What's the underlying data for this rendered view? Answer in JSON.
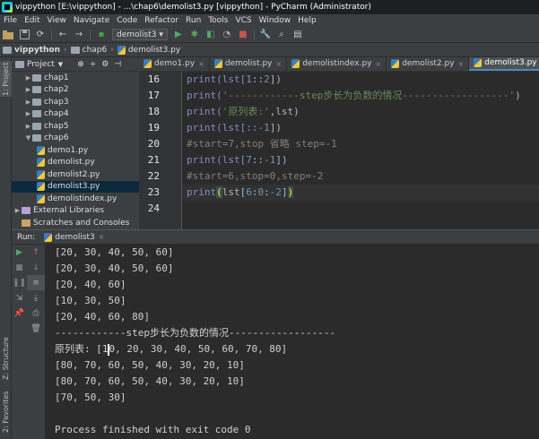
{
  "window": {
    "title": "vippython [E:\\vippython] - ...\\chap6\\demolist3.py [vippython] - PyCharm (Administrator)"
  },
  "menu": [
    "File",
    "Edit",
    "View",
    "Navigate",
    "Code",
    "Refactor",
    "Run",
    "Tools",
    "VCS",
    "Window",
    "Help"
  ],
  "toolbar": {
    "run_config": "demolist3 ▾"
  },
  "breadcrumbs": [
    "vippython",
    "chap6",
    "demolist3.py"
  ],
  "project_panel": {
    "title": "Project",
    "tree": [
      {
        "label": "chap1",
        "type": "folder",
        "depth": 1,
        "expanded": false
      },
      {
        "label": "chap2",
        "type": "folder",
        "depth": 1,
        "expanded": false
      },
      {
        "label": "chap3",
        "type": "folder",
        "depth": 1,
        "expanded": false
      },
      {
        "label": "chap4",
        "type": "folder",
        "depth": 1,
        "expanded": false
      },
      {
        "label": "chap5",
        "type": "folder",
        "depth": 1,
        "expanded": false
      },
      {
        "label": "chap6",
        "type": "folder",
        "depth": 1,
        "expanded": true
      },
      {
        "label": "demo1.py",
        "type": "file",
        "depth": 2
      },
      {
        "label": "demolist.py",
        "type": "file",
        "depth": 2
      },
      {
        "label": "demolist2.py",
        "type": "file",
        "depth": 2
      },
      {
        "label": "demolist3.py",
        "type": "file",
        "depth": 2,
        "selected": true
      },
      {
        "label": "demolistindex.py",
        "type": "file",
        "depth": 2
      },
      {
        "label": "External Libraries",
        "type": "lib",
        "depth": 0,
        "expanded": false
      },
      {
        "label": "Scratches and Consoles",
        "type": "scratch",
        "depth": 0
      }
    ]
  },
  "left_strip": {
    "project_tab": "1: Project",
    "structure_tab": "Z: Structure",
    "favorites_tab": "2: Favorites"
  },
  "tabs": [
    {
      "label": "demo1.py",
      "active": false
    },
    {
      "label": "demolist.py",
      "active": false
    },
    {
      "label": "demolistindex.py",
      "active": false
    },
    {
      "label": "demolist2.py",
      "active": false
    },
    {
      "label": "demolist3.py",
      "active": true
    }
  ],
  "editor": {
    "line_numbers": [
      "16",
      "17",
      "18",
      "19",
      "20",
      "21",
      "22",
      "23",
      "24"
    ],
    "lines": [
      {
        "pre": "print(lst[1",
        "mid": "::",
        "num": "2",
        "post": "])",
        "type": "code"
      },
      {
        "pre": "print(",
        "str": "'------------step步长为负数的情况------------------'",
        "post": ")",
        "type": "str"
      },
      {
        "pre": "print(",
        "str": "'原列表:'",
        "post": ",lst)",
        "type": "str"
      },
      {
        "pre": "print(lst[::",
        "num": "-1",
        "post": "])",
        "type": "code2"
      },
      {
        "text": "#start=7,stop 省略 step=-1",
        "type": "comment"
      },
      {
        "pre": "print(lst[",
        "num": "7",
        "mid": "::",
        "num2": "-1",
        "post": "])",
        "type": "code3"
      },
      {
        "text": "#start=6,stop=0,step=-2",
        "type": "comment"
      },
      {
        "pre": "print",
        "brk_open": "(",
        "inner": "lst[",
        "n1": "6",
        "c1": ":",
        "n2": "0",
        "c2": ":",
        "n3": "-2",
        "close": "]",
        "brk_close": ")",
        "type": "current"
      },
      {
        "text": "",
        "type": "empty"
      }
    ]
  },
  "run_panel": {
    "label": "Run:",
    "config": "demolist3",
    "output": [
      "[20, 30, 40, 50, 60]",
      "[20, 30, 40, 50, 60]",
      "[20, 40, 60]",
      "[10, 30, 50]",
      "[20, 40, 60, 80]",
      "------------step步长为负数的情况------------------",
      "原列表: [10, 20, 30, 40, 50, 60, 70, 80]",
      "[80, 70, 60, 50, 40, 30, 20, 10]",
      "[80, 70, 60, 50, 40, 30, 20, 10]",
      "[70, 50, 30]",
      "",
      "Process finished with exit code 0"
    ]
  },
  "colors": {
    "bg": "#2b2b2b",
    "panel": "#3c3f41",
    "selection": "#0d293e",
    "string": "#6a8759",
    "number": "#6897bb",
    "comment": "#808080",
    "builtin": "#8888c6"
  }
}
